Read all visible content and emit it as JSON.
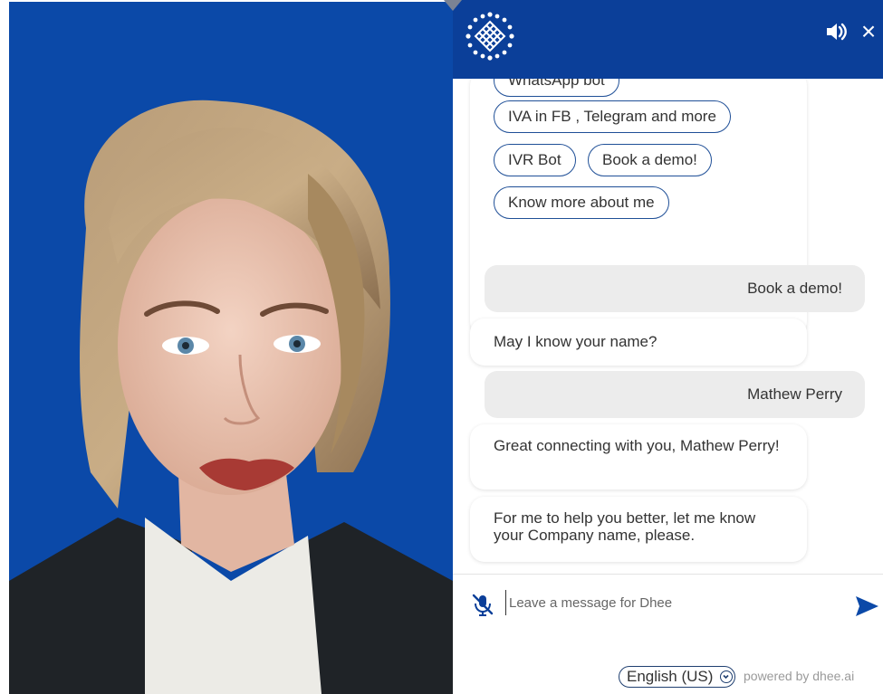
{
  "header": {
    "logo_icon": "dhee-knot-logo-icon",
    "speaker_icon": "speaker-volume-icon",
    "close_label": "×"
  },
  "chips": [
    {
      "label": "WhatsApp bot"
    },
    {
      "label": "IVA in FB , Telegram and more"
    },
    {
      "label": "IVR Bot"
    },
    {
      "label": "Book a demo!"
    },
    {
      "label": "Know more about me"
    }
  ],
  "messages": [
    {
      "sender": "user",
      "text": "Book a demo!"
    },
    {
      "sender": "bot",
      "text": "May I know your name?"
    },
    {
      "sender": "user",
      "text": "Mathew Perry"
    },
    {
      "sender": "bot",
      "text": "Great connecting with you, Mathew Perry!"
    },
    {
      "sender": "bot",
      "text": "For me to help you better, let me know your Company name, please."
    }
  ],
  "input": {
    "placeholder": "Leave a message for Dhee",
    "mic_icon": "mic-muted-icon",
    "send_icon": "send-arrow-icon"
  },
  "footer": {
    "language": "English (US)",
    "powered_by": "powered by dhee.ai"
  },
  "colors": {
    "header_bg": "#0b3f99",
    "avatar_bg": "#0b49a8",
    "chip_border": "#1f4f97",
    "user_bubble_bg": "#ececec",
    "send_icon": "#0b49a8"
  }
}
